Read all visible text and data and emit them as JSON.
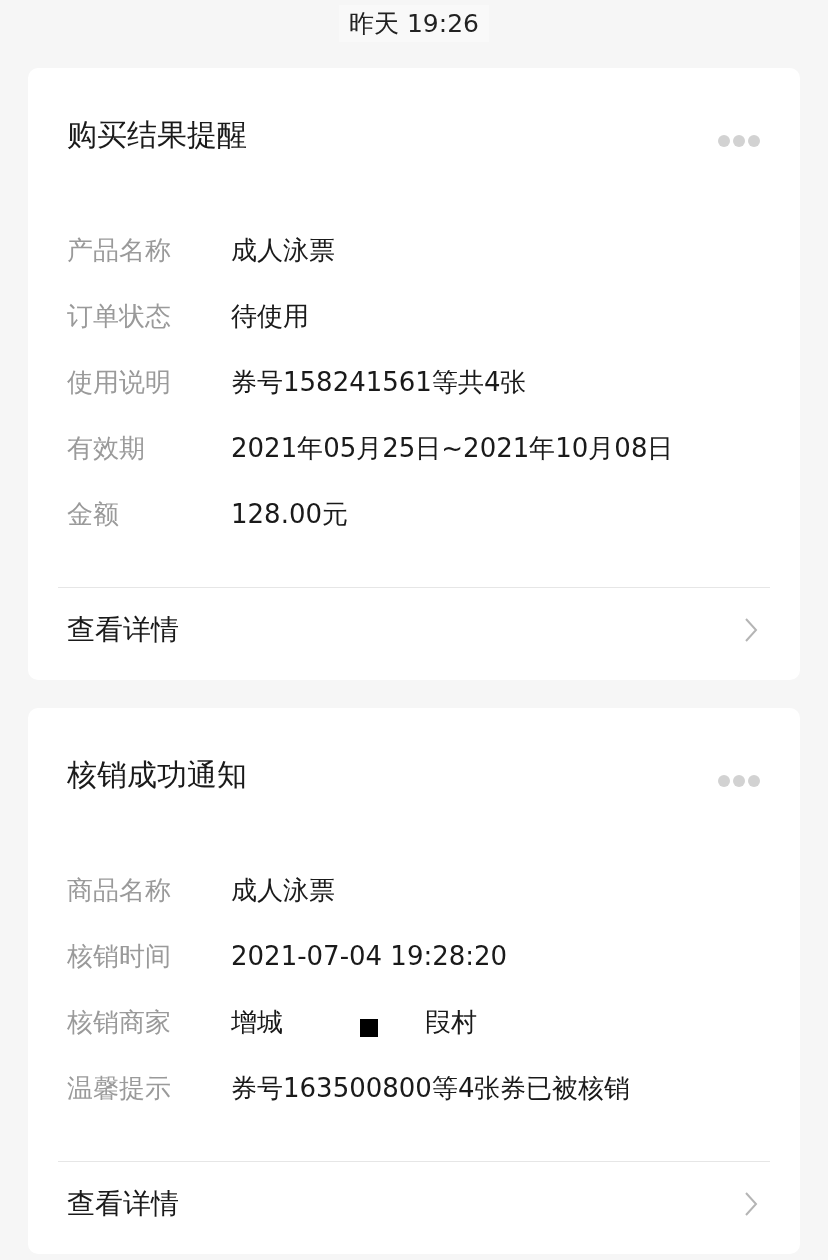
{
  "timestamp": "昨天 19:26",
  "cards": [
    {
      "title": "购买结果提醒",
      "fields": [
        {
          "label": "产品名称",
          "value": [
            "成人泳票"
          ]
        },
        {
          "label": "订单状态",
          "value": [
            "待使用"
          ]
        },
        {
          "label": "使用说明",
          "value": [
            "券号158241561等共4张"
          ]
        },
        {
          "label": "有效期",
          "value": [
            "2021年05月25日~2021年10月08日"
          ]
        },
        {
          "label": "金额",
          "value": [
            "128.00元"
          ]
        }
      ],
      "footer": "查看详情"
    },
    {
      "title": "核销成功通知",
      "fields": [
        {
          "label": "商品名称",
          "value": [
            "成人泳票"
          ]
        },
        {
          "label": "核销时间",
          "value": [
            "2021-07-04 19:28:20"
          ]
        },
        {
          "label": "核销商家",
          "value": [
            "增城",
            "叚村"
          ]
        },
        {
          "label": "温馨提示",
          "value": [
            "券号163500800等4张券已被核销"
          ]
        }
      ],
      "footer": "查看详情"
    }
  ]
}
